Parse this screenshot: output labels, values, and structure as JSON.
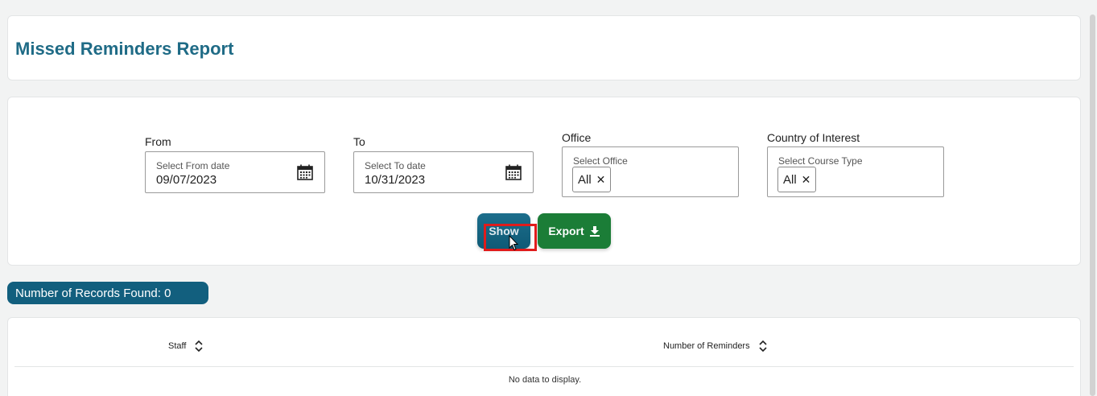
{
  "header": {
    "title": "Missed Reminders Report"
  },
  "filters": {
    "from": {
      "label": "From",
      "placeholder": "Select From date",
      "value": "09/07/2023",
      "icon": "calendar-icon"
    },
    "to": {
      "label": "To",
      "placeholder": "Select To date",
      "value": "10/31/2023",
      "icon": "calendar-icon"
    },
    "office": {
      "label": "Office",
      "placeholder": "Select Office",
      "chip": "All",
      "chip_remove": "✕"
    },
    "country": {
      "label": "Country of Interest",
      "placeholder": "Select Course Type",
      "chip": "All",
      "chip_remove": "✕"
    }
  },
  "actions": {
    "show_label": "Show",
    "export_label": "Export",
    "export_icon": "download-icon"
  },
  "results": {
    "records_found": "Number of Records Found: 0"
  },
  "table": {
    "columns": [
      {
        "label": "Staff",
        "icon": "sort-icon"
      },
      {
        "label": "Number of Reminders",
        "icon": "sort-icon"
      }
    ],
    "empty_message": "No data to display."
  },
  "colors": {
    "title": "#1f6b86",
    "show_button": "#125f7e",
    "export_button": "#1b7d37",
    "records_badge": "#125f7e",
    "highlight": "#e01b1b"
  }
}
